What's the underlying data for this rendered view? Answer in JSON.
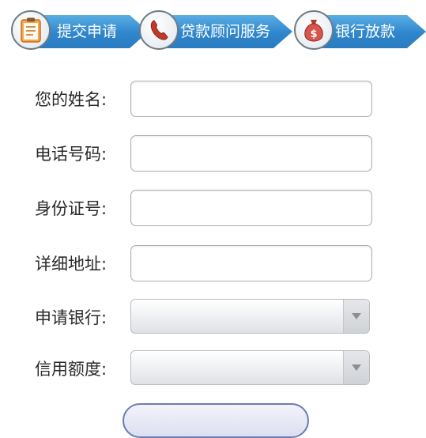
{
  "steps": [
    {
      "label": "提交申请",
      "icon": "clipboard-icon"
    },
    {
      "label": "贷款顾问服务",
      "icon": "phone-icon"
    },
    {
      "label": "银行放款",
      "icon": "money-bag-icon"
    }
  ],
  "form": {
    "name_label": "您的姓名:",
    "phone_label": "电话号码:",
    "id_label": "身份证号:",
    "address_label": "详细地址:",
    "bank_label": "申请银行:",
    "credit_label": "信用额度:"
  },
  "colors": {
    "step_arrow": "#2f86cc",
    "step_text": "#ffffff",
    "label_text": "#2a2a2a",
    "field_border": "#a9aeb3"
  }
}
